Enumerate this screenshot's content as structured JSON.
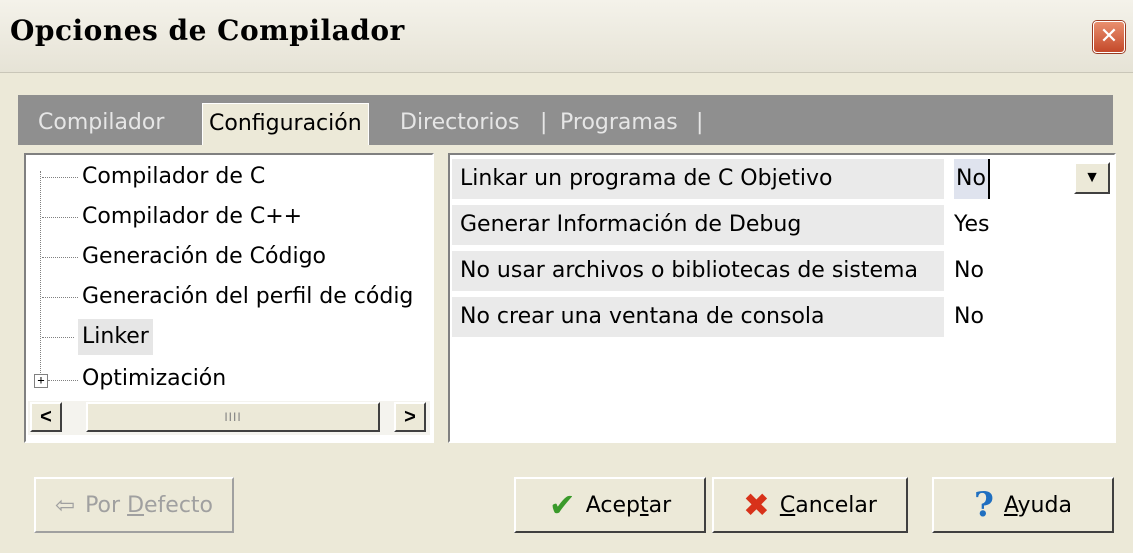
{
  "window": {
    "title": "Opciones de Compilador",
    "close_glyph": "✕"
  },
  "tabs": {
    "compilador": "Compilador",
    "configuracion": "Configuración",
    "directorios": "Directorios",
    "programas": "Programas",
    "separator": "|"
  },
  "tree": {
    "items": [
      "Compilador de C",
      "Compilador de C++",
      "Generación de Código",
      "Generación del perfil de códig",
      "Linker",
      "Optimización"
    ],
    "expander_glyph": "+",
    "scroll_left": "<",
    "scroll_right": ">",
    "thumb_grip": "IIII"
  },
  "properties": [
    {
      "name": "Linkar un programa de C Objetivo",
      "value": "No"
    },
    {
      "name": "Generar Información de Debug",
      "value": "Yes"
    },
    {
      "name": "No usar archivos o bibliotecas de sistema",
      "value": "No"
    },
    {
      "name": "No crear una ventana de consola",
      "value": "No"
    }
  ],
  "dropdown_glyph": "▼",
  "buttons": {
    "por_defecto_prefix": "Por ",
    "por_defecto_accel": "D",
    "por_defecto_rest": "efecto",
    "aceptar_prefix": "Acep",
    "aceptar_accel": "t",
    "aceptar_rest": "ar",
    "cancelar_accel": "C",
    "cancelar_rest": "ancelar",
    "ayuda_accel": "A",
    "ayuda_rest": "yuda"
  },
  "icons": {
    "default": "left-arrow-icon",
    "ok": "check-icon",
    "cancel": "x-icon",
    "help": "help-icon"
  },
  "colors": {
    "face": "#ece9d8",
    "tab_strip": "#8f8f8f",
    "check": "#3a9a2a",
    "cross": "#d8321a",
    "help": "#1f6fc0"
  }
}
